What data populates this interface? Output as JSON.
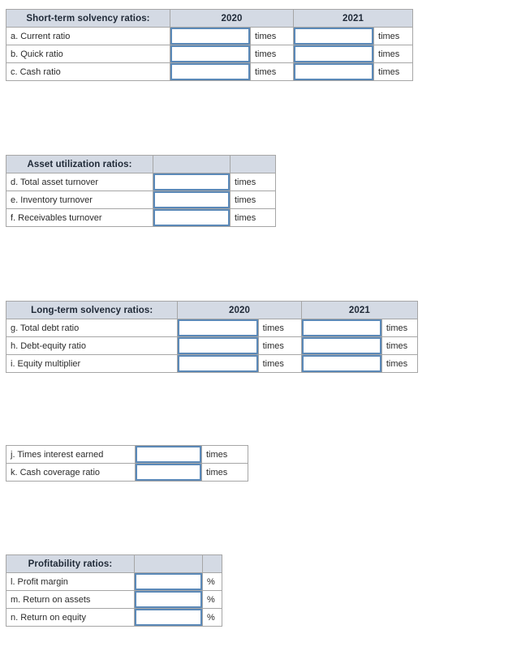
{
  "colors": {
    "header_bg": "#d4dae4",
    "table_border": "#a6a6a6",
    "input_border": "#5b89b8",
    "marker": "#3f73b5",
    "text": "#2a2a2a"
  },
  "tables": [
    {
      "id": "short-term",
      "header": {
        "title": "Short-term solvency ratios:",
        "col1": "2020",
        "col2": "2021"
      },
      "rows": [
        {
          "label": "a. Current ratio",
          "value1": "",
          "unit1": "times",
          "value2": "",
          "unit2": "times"
        },
        {
          "label": "b. Quick ratio",
          "value1": "",
          "unit1": "times",
          "value2": "",
          "unit2": "times"
        },
        {
          "label": "c. Cash ratio",
          "value1": "",
          "unit1": "times",
          "value2": "",
          "unit2": "times"
        }
      ]
    },
    {
      "id": "asset",
      "header": {
        "title": "Asset utilization ratios:",
        "col1": "",
        "col2": ""
      },
      "rows": [
        {
          "label": "d. Total asset turnover",
          "value1": "",
          "unit1": "times"
        },
        {
          "label": "e. Inventory turnover",
          "value1": "",
          "unit1": "times"
        },
        {
          "label": "f. Receivables turnover",
          "value1": "",
          "unit1": "times"
        }
      ]
    },
    {
      "id": "long-term",
      "header": {
        "title": "Long-term solvency ratios:",
        "col1": "2020",
        "col2": "2021"
      },
      "rows": [
        {
          "label": "g. Total debt ratio",
          "value1": "",
          "unit1": "times",
          "value2": "",
          "unit2": "times"
        },
        {
          "label": "h. Debt-equity ratio",
          "value1": "",
          "unit1": "times",
          "value2": "",
          "unit2": "times"
        },
        {
          "label": "i. Equity multiplier",
          "value1": "",
          "unit1": "times",
          "value2": "",
          "unit2": "times"
        }
      ]
    },
    {
      "id": "coverage",
      "header": null,
      "rows": [
        {
          "label": "j. Times interest earned",
          "value1": "",
          "unit1": "times"
        },
        {
          "label": "k. Cash coverage ratio",
          "value1": "",
          "unit1": "times"
        }
      ]
    },
    {
      "id": "profit",
      "header": {
        "title": "Profitability ratios:",
        "col1": "",
        "col2": ""
      },
      "rows": [
        {
          "label": "l. Profit margin",
          "value1": "",
          "unit1": "%"
        },
        {
          "label": "m. Return on assets",
          "value1": "",
          "unit1": "%"
        },
        {
          "label": "n. Return on equity",
          "value1": "",
          "unit1": "%"
        }
      ]
    }
  ]
}
